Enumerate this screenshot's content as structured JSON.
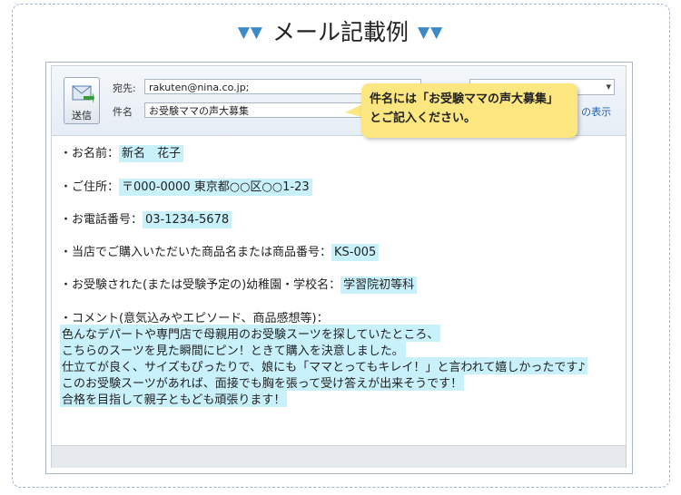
{
  "heading": {
    "title": "メール記載例",
    "left_marks": "▼▼",
    "right_marks": "▼▼"
  },
  "compose": {
    "send_button_label": "送信",
    "to_label": "宛先:",
    "to_value": "rakuten@nina.co.jp;",
    "subject_label": "件名",
    "subject_value": "お受験ママの声大募集",
    "show_link": "C の表示"
  },
  "callout": {
    "line1": "件名には「お受験ママの声大募集」",
    "line2": "とご記入ください。"
  },
  "fields": [
    {
      "label": "・お名前：",
      "value": "新名　花子"
    },
    {
      "label": "・ご住所：",
      "value": "〒000-0000 東京都○○区○○1-23"
    },
    {
      "label": "・お電話番号：",
      "value": "03-1234-5678"
    },
    {
      "label": "・当店でご購入いただいた商品名または商品番号：",
      "value": "KS-005"
    },
    {
      "label": "・お受験された(または受験予定の)幼稚園・学校名：",
      "value": "学習院初等科"
    }
  ],
  "comment": {
    "label": "・コメント(意気込みやエピソード、商品感想等)：",
    "lines": [
      "色んなデパートや専門店で母親用のお受験スーツを探していたところ、",
      "こちらのスーツを見た瞬間にピン！ときて購入を決意しました。",
      "仕立てが良く、サイズもぴったりで、娘にも「ママとってもキレイ！」と言われて嬉しかったです♪",
      "このお受験スーツがあれば、面接でも胸を張って受け答えが出来そうです！",
      "合格を目指して親子ともども頑張ります！"
    ]
  },
  "colors": {
    "accent": "#3d8ac9",
    "highlight": "#c9f1fb",
    "callout": "#fbe680"
  }
}
